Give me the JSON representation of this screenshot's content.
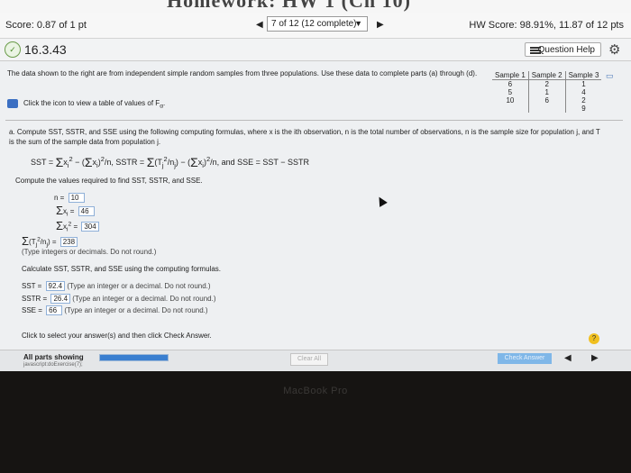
{
  "window": {
    "title_fragment": "Homework: HW 1 (Ch 10)"
  },
  "scorebar": {
    "score": "Score: 0.87 of 1 pt",
    "question_select": "7 of 12 (12 complete)",
    "hw_score": "HW Score: 98.91%, 11.87 of 12 pts"
  },
  "header": {
    "question_number": "16.3.43",
    "help_label": "Question Help"
  },
  "intro": {
    "text": "The data shown to the right are from independent simple random samples from three populations. Use these data to complete parts (a) through (d).",
    "icon_note": "Click the icon to view a table of values of F"
  },
  "sample_table": {
    "headers": [
      "Sample 1",
      "Sample 2",
      "Sample 3"
    ],
    "rows": [
      [
        "6",
        "2",
        "1"
      ],
      [
        "5",
        "1",
        "4"
      ],
      [
        "10",
        "6",
        "2"
      ],
      [
        "",
        "",
        "9"
      ]
    ]
  },
  "part_a": {
    "text": "a. Compute SST, SSTR, and SSE using the following computing formulas, where x is the ith observation, n is the total number of observations, n is the sample size for population j, and T is the sum of the sample data from population j.",
    "formula_sst": "SST =",
    "formula_sstr": "/n, SSTR =",
    "formula_tail": "/n, and SSE = SST − SSTR",
    "compute_prompt": "Compute the values required to find SST, SSTR, and SSE."
  },
  "values": {
    "n_label": "n =",
    "n": "10",
    "sum_x": "46",
    "sum_x2": "304",
    "sum_t": "238",
    "type_hint": "(Type integers or decimals. Do not round.)",
    "calc_prompt": "Calculate SST, SSTR, and SSE using the computing formulas.",
    "sst_label": "SST =",
    "sst": "92.4",
    "sst_hint": "(Type an integer or a decimal. Do not round.)",
    "sstr_label": "SSTR =",
    "sstr": "26.4",
    "sstr_hint": "(Type an integer or a decimal. Do not round.)",
    "sse_label": "SSE =",
    "sse": "66",
    "sse_hint": "(Type an integer or a decimal. Do not round.)"
  },
  "footer": {
    "click_note": "Click to select your answer(s) and then click Check Answer.",
    "all_parts": "All parts showing",
    "js_text": "javascript:doExercise(7);",
    "progress_fraction": 1.0,
    "clear_all": "Clear All",
    "check_answer": "Check Answer",
    "hint": "?"
  },
  "bezel": {
    "label": "MacBook Pro"
  }
}
